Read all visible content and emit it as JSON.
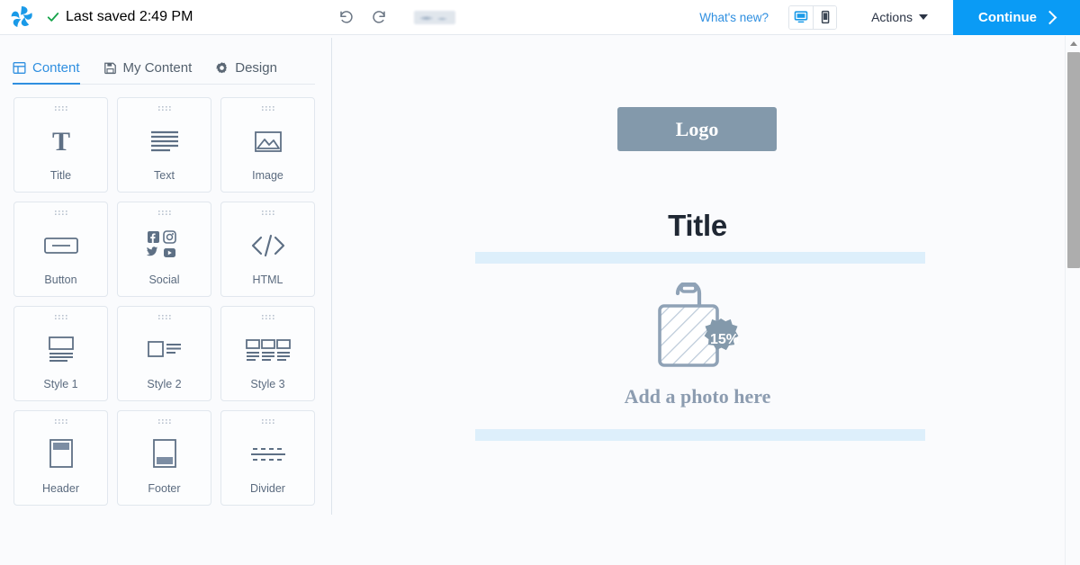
{
  "topbar": {
    "brand_icon": "pinwheel-logo-icon",
    "check_icon": "check-icon",
    "saved_status": "Last saved 2:49 PM",
    "undo_icon": "undo-icon",
    "redo_icon": "redo-icon",
    "redacted_label": "",
    "whats_new": "What's new?",
    "desktop_icon": "desktop-icon",
    "mobile_icon": "mobile-icon",
    "active_view": "desktop",
    "actions_label": "Actions",
    "continue_label": "Continue",
    "accent_color": "#0a9bf5",
    "link_color": "#2f8fe0"
  },
  "sidebar": {
    "tabs": [
      {
        "label": "Content",
        "icon": "grid-icon",
        "active": true
      },
      {
        "label": "My Content",
        "icon": "save-icon",
        "active": false
      },
      {
        "label": "Design",
        "icon": "gear-icon",
        "active": false
      }
    ],
    "blocks": [
      {
        "label": "Title",
        "icon": "title-T-icon"
      },
      {
        "label": "Text",
        "icon": "text-lines-icon"
      },
      {
        "label": "Image",
        "icon": "image-icon"
      },
      {
        "label": "Button",
        "icon": "button-icon"
      },
      {
        "label": "Social",
        "icon": "social-icons"
      },
      {
        "label": "HTML",
        "icon": "code-icon"
      },
      {
        "label": "Style 1",
        "icon": "style1-icon"
      },
      {
        "label": "Style 2",
        "icon": "style2-icon"
      },
      {
        "label": "Style 3",
        "icon": "style3-icon"
      },
      {
        "label": "Header",
        "icon": "header-icon"
      },
      {
        "label": "Footer",
        "icon": "footer-icon"
      },
      {
        "label": "Divider",
        "icon": "divider-icon"
      }
    ],
    "drag_handle_icon": "drag-grip-icon"
  },
  "canvas": {
    "logo_placeholder": "Logo",
    "title_text": "Title",
    "photo_caption": "Add a photo here",
    "bag_badge": "15%",
    "bag_icon": "shopping-bag-icon",
    "drop_zone_color": "#ddeffb",
    "logo_block_color": "#8399ab"
  },
  "scrollbar": {
    "up_arrow_icon": "scroll-up-arrow-icon",
    "thumb_name": "scroll-thumb"
  }
}
